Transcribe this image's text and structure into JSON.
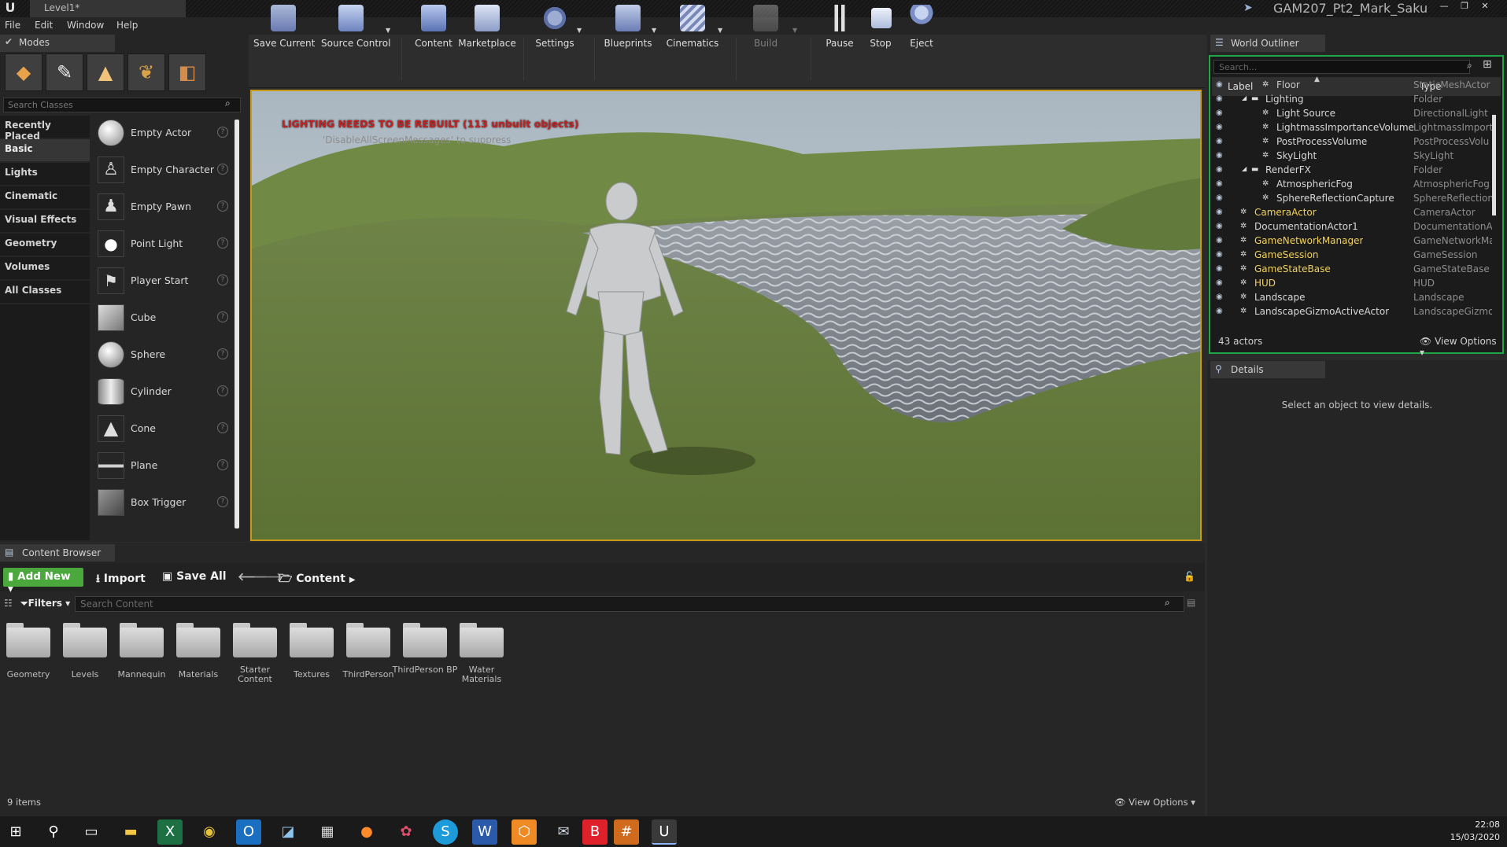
{
  "window": {
    "level_tab": "Level1*",
    "project": "GAM207_Pt2_Mark_Saku"
  },
  "menu": [
    "File",
    "Edit",
    "Window",
    "Help"
  ],
  "modes": {
    "tab": "Modes",
    "search_placeholder": "Search Classes",
    "categories": [
      "Recently Placed",
      "Basic",
      "Lights",
      "Cinematic",
      "Visual Effects",
      "Geometry",
      "Volumes",
      "All Classes"
    ],
    "active_category": "Basic",
    "items": [
      "Empty Actor",
      "Empty Character",
      "Empty Pawn",
      "Point Light",
      "Player Start",
      "Cube",
      "Sphere",
      "Cylinder",
      "Cone",
      "Plane",
      "Box Trigger"
    ]
  },
  "toolbar": {
    "buttons": [
      {
        "label": "Save Current",
        "icon": "save-icon"
      },
      {
        "label": "Source Control",
        "icon": "source-control-icon"
      },
      {
        "label": "Content",
        "icon": "content-icon"
      },
      {
        "label": "Marketplace",
        "icon": "marketplace-icon"
      },
      {
        "label": "Settings",
        "icon": "settings-icon"
      },
      {
        "label": "Blueprints",
        "icon": "blueprints-icon"
      },
      {
        "label": "Cinematics",
        "icon": "cinematics-icon"
      },
      {
        "label": "Build",
        "icon": "build-icon"
      },
      {
        "label": "Pause",
        "icon": "pause-icon"
      },
      {
        "label": "Stop",
        "icon": "stop-icon"
      },
      {
        "label": "Eject",
        "icon": "eject-icon"
      }
    ]
  },
  "viewport": {
    "warning": "LIGHTING NEEDS TO BE REBUILT (113 unbuilt objects)",
    "hint": "'DisableAllScreenMessages' to suppress"
  },
  "outliner": {
    "tab": "World Outliner",
    "search_placeholder": "Search...",
    "col_label": "Label",
    "col_type": "Type",
    "rows": [
      {
        "label": "Floor",
        "type": "StaticMeshActor",
        "indent": 2,
        "color": "#c8c8c8"
      },
      {
        "label": "Lighting",
        "type": "Folder",
        "indent": 1,
        "color": "#d8d8d8"
      },
      {
        "label": "Light Source",
        "type": "DirectionalLight",
        "indent": 2,
        "color": "#d8d8d8"
      },
      {
        "label": "LightmassImportanceVolume",
        "type": "LightmassImporta",
        "indent": 2,
        "color": "#d8d8d8"
      },
      {
        "label": "PostProcessVolume",
        "type": "PostProcessVolu",
        "indent": 2,
        "color": "#d8d8d8"
      },
      {
        "label": "SkyLight",
        "type": "SkyLight",
        "indent": 2,
        "color": "#d8d8d8"
      },
      {
        "label": "RenderFX",
        "type": "Folder",
        "indent": 1,
        "color": "#d8d8d8"
      },
      {
        "label": "AtmosphericFog",
        "type": "AtmosphericFog",
        "indent": 2,
        "color": "#d8d8d8"
      },
      {
        "label": "SphereReflectionCapture",
        "type": "SphereReflectionC",
        "indent": 2,
        "color": "#d8d8d8"
      },
      {
        "label": "CameraActor",
        "type": "CameraActor",
        "indent": 0,
        "color": "#f2d15a"
      },
      {
        "label": "DocumentationActor1",
        "type": "DocumentationAc",
        "indent": 0,
        "color": "#d8d8d8"
      },
      {
        "label": "GameNetworkManager",
        "type": "GameNetworkMar",
        "indent": 0,
        "color": "#f2d15a"
      },
      {
        "label": "GameSession",
        "type": "GameSession",
        "indent": 0,
        "color": "#f2d15a"
      },
      {
        "label": "GameStateBase",
        "type": "GameStateBase",
        "indent": 0,
        "color": "#f2d15a"
      },
      {
        "label": "HUD",
        "type": "HUD",
        "indent": 0,
        "color": "#f2d15a"
      },
      {
        "label": "Landscape",
        "type": "Landscape",
        "indent": 0,
        "color": "#d8d8d8"
      },
      {
        "label": "LandscapeGizmoActiveActor",
        "type": "LandscapeGizmo",
        "indent": 0,
        "color": "#d8d8d8"
      }
    ],
    "count": "43 actors",
    "view_options": "View Options"
  },
  "details": {
    "tab": "Details",
    "message": "Select an object to view details."
  },
  "content_browser": {
    "tab": "Content Browser",
    "add_new": "Add New",
    "import": "Import",
    "save_all": "Save All",
    "path": "Content",
    "filters": "Filters",
    "search_placeholder": "Search Content",
    "folders": [
      "Geometry",
      "Levels",
      "Mannequin",
      "Materials",
      "Starter Content",
      "Textures",
      "ThirdPerson",
      "ThirdPerson BP",
      "Water Materials"
    ],
    "items_count": "9 items",
    "view_options": "View Options"
  },
  "taskbar": {
    "time": "22:08",
    "date": "15/03/2020"
  },
  "colors": {
    "accent_green": "#4aa83c",
    "viewport_border": "#c79a1a",
    "warning_red": "#c22222",
    "outliner_border": "#1fa845"
  }
}
